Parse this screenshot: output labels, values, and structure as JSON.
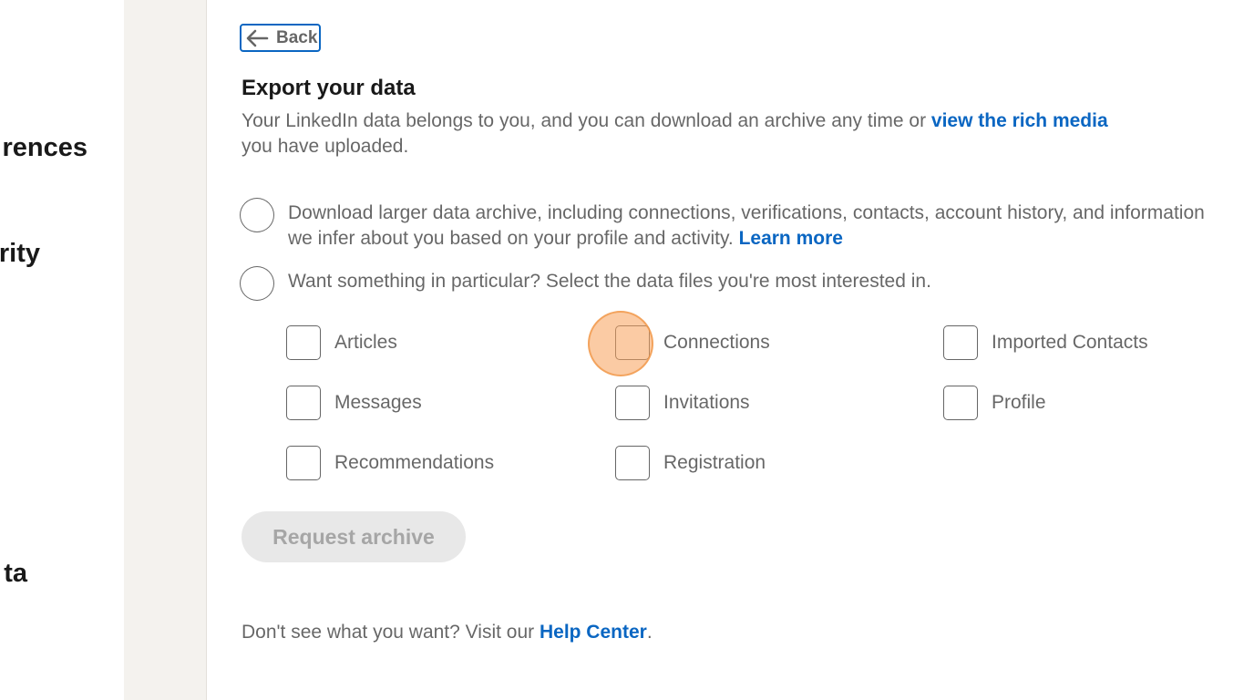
{
  "nav": {
    "items": [
      {
        "label": "rences"
      },
      {
        "label": "rity"
      },
      {
        "label": "ta"
      }
    ]
  },
  "back_label": "Back",
  "title": "Export your data",
  "intro": {
    "text": "Your LinkedIn data belongs to you, and you can download an archive any time or ",
    "link": "view the rich media",
    "text_after": "you have uploaded."
  },
  "options": {
    "full": {
      "text": "Download larger data archive, including connections, verifications, contacts, account history, and information we infer about you based on your profile and activity. ",
      "link": "Learn more"
    },
    "partial": {
      "text": "Want something in particular? Select the data files you're most interested in."
    }
  },
  "files": [
    "Articles",
    "Connections",
    "Imported Contacts",
    "Messages",
    "Invitations",
    "Profile",
    "Recommendations",
    "Registration"
  ],
  "request_label": "Request archive",
  "footer": {
    "text": "Don't see what you want? Visit our ",
    "link": "Help Center",
    "end": "."
  },
  "colors": {
    "link": "#0a66c2",
    "gutter": "#f4f2ee",
    "disabled_button": "#e8e8e8",
    "click_marker": "#f7a05a"
  }
}
